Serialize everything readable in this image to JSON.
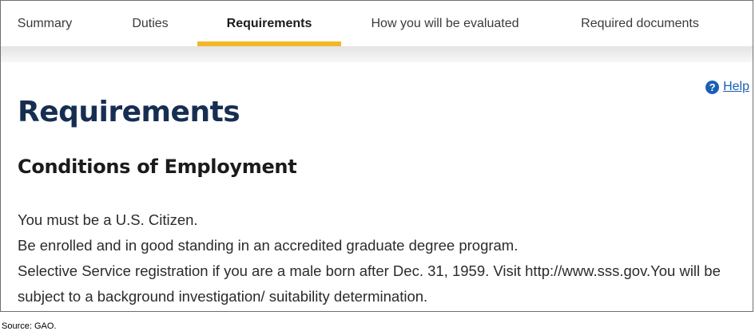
{
  "tabs": [
    {
      "label": "Summary",
      "active": false
    },
    {
      "label": "Duties",
      "active": false
    },
    {
      "label": "Requirements",
      "active": true
    },
    {
      "label": "How you will be evaluated",
      "active": false
    },
    {
      "label": "Required documents",
      "active": false
    }
  ],
  "help": {
    "icon": "question-circle-icon",
    "icon_glyph": "?",
    "label": "Help"
  },
  "main": {
    "title": "Requirements",
    "section_title": "Conditions of Employment",
    "lines": [
      "You must be a U.S. Citizen.",
      "Be enrolled and in good standing in an accredited graduate degree program.",
      "Selective Service registration if you are a male born after Dec. 31, 1959. Visit http://www.sss.gov.You will be subject to a background investigation/ suitability determination."
    ]
  },
  "source": "Source: GAO.",
  "colors": {
    "accent": "#f2b829",
    "title": "#162e51",
    "link": "#1a5fb4"
  }
}
